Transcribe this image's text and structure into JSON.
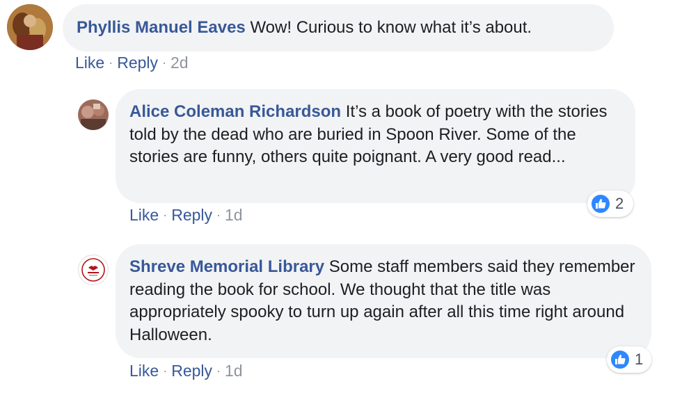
{
  "comments": [
    {
      "author": "Phyllis Manuel Eaves",
      "text": "Wow! Curious to know what it’s about.",
      "actions": {
        "like": "Like",
        "reply": "Reply",
        "time": "2d"
      }
    },
    {
      "author": "Alice Coleman Richardson",
      "text": "It’s a book of poetry with the stories told by the dead who are buried in Spoon River. Some of the stories are funny, others quite poignant. A very good read...",
      "actions": {
        "like": "Like",
        "reply": "Reply",
        "time": "1d"
      },
      "reaction_count": "2"
    },
    {
      "author": "Shreve Memorial Library",
      "text": "Some staff members said they remember reading the book for school. We thought that the title was appropriately spooky to turn up again after all this time right around Halloween.",
      "actions": {
        "like": "Like",
        "reply": "Reply",
        "time": "1d"
      },
      "reaction_count": "1"
    }
  ],
  "icons": {
    "reaction": "like-thumb-icon"
  },
  "colors": {
    "author": "#385898",
    "bubble": "#f2f3f5",
    "like_badge": "#2d88ff",
    "meta": "#90949c"
  },
  "separator": "·"
}
